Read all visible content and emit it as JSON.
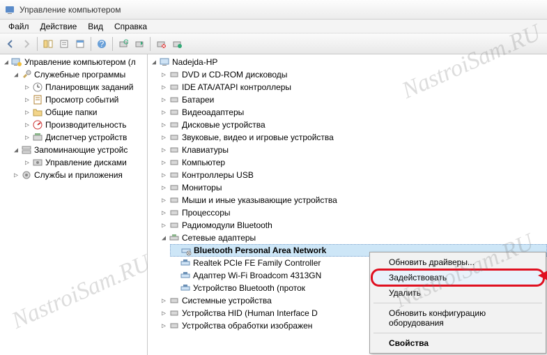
{
  "title": "Управление компьютером",
  "menus": {
    "file": "Файл",
    "action": "Действие",
    "view": "Вид",
    "help": "Справка"
  },
  "left_tree": {
    "root": "Управление компьютером (л",
    "groups": [
      {
        "label": "Служебные программы",
        "items": [
          "Планировщик заданий",
          "Просмотр событий",
          "Общие папки",
          "Производительность",
          "Диспетчер устройств"
        ]
      },
      {
        "label": "Запоминающие устройс",
        "items": [
          "Управление дисками"
        ]
      },
      {
        "label": "Службы и приложения",
        "items": []
      }
    ]
  },
  "right_tree": {
    "root": "Nadejda-HP",
    "categories": [
      "DVD и CD-ROM дисководы",
      "IDE ATA/ATAPI контроллеры",
      "Батареи",
      "Видеоадаптеры",
      "Дисковые устройства",
      "Звуковые, видео и игровые устройства",
      "Клавиатуры",
      "Компьютер",
      "Контроллеры USB",
      "Мониторы",
      "Мыши и иные указывающие устройства",
      "Процессоры",
      "Радиомодули Bluetooth"
    ],
    "network_label": "Сетевые адаптеры",
    "network_items": [
      "Bluetooth Personal Area Network",
      "Realtek PCIe FE Family Controller",
      "Адаптер Wi-Fi Broadcom 4313GN",
      "Устройство Bluetooth (проток"
    ],
    "tail": [
      "Системные устройства",
      "Устройства HID (Human Interface D",
      "Устройства обработки изображен"
    ]
  },
  "context_menu": {
    "update": "Обновить драйверы...",
    "enable": "Задействовать",
    "delete": "Удалить",
    "scan": "Обновить конфигурацию оборудования",
    "props": "Свойства"
  },
  "watermark": "NastroiSam.RU"
}
